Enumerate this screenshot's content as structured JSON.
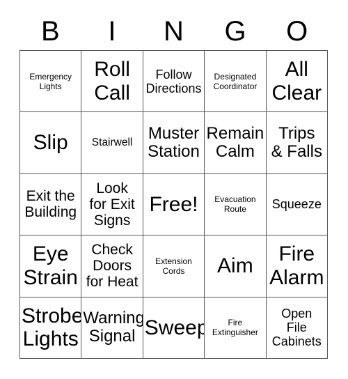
{
  "card": {
    "title": "BINGO",
    "header_letters": [
      "B",
      "I",
      "N",
      "G",
      "O"
    ],
    "rows": 5,
    "columns": 5,
    "border_color": "#555555",
    "text_color": "#000000",
    "background_color": "#ffffff"
  },
  "grid": {
    "cells": [
      {
        "text": "Emergency\nLights",
        "size": "fs-xs",
        "column": "B",
        "row": 1,
        "free": false
      },
      {
        "text": "Roll\nCall",
        "size": "fs-xxl",
        "column": "I",
        "row": 1,
        "free": false
      },
      {
        "text": "Follow\nDirections",
        "size": "fs-md",
        "column": "N",
        "row": 1,
        "free": false
      },
      {
        "text": "Designated\nCoordinator",
        "size": "fs-xs",
        "column": "G",
        "row": 1,
        "free": false
      },
      {
        "text": "All\nClear",
        "size": "fs-xxl",
        "column": "O",
        "row": 1,
        "free": false
      },
      {
        "text": "Slip",
        "size": "fs-xxl",
        "column": "B",
        "row": 2,
        "free": false
      },
      {
        "text": "Stairwell",
        "size": "fs-sm",
        "column": "I",
        "row": 2,
        "free": false
      },
      {
        "text": "Muster\nStation",
        "size": "fs-xl",
        "column": "N",
        "row": 2,
        "free": false
      },
      {
        "text": "Remain\nCalm",
        "size": "fs-xl",
        "column": "G",
        "row": 2,
        "free": false
      },
      {
        "text": "Trips\n& Falls",
        "size": "fs-xl",
        "column": "O",
        "row": 2,
        "free": false
      },
      {
        "text": "Exit the\nBuilding",
        "size": "fs-lg",
        "column": "B",
        "row": 3,
        "free": false
      },
      {
        "text": "Look\nfor Exit\nSigns",
        "size": "fs-lg",
        "column": "I",
        "row": 3,
        "free": false
      },
      {
        "text": "Free!",
        "size": "fs-xxl",
        "column": "N",
        "row": 3,
        "free": true
      },
      {
        "text": "Evacuation\nRoute",
        "size": "fs-xs",
        "column": "G",
        "row": 3,
        "free": false
      },
      {
        "text": "Squeeze",
        "size": "fs-md",
        "column": "O",
        "row": 3,
        "free": false
      },
      {
        "text": "Eye\nStrain",
        "size": "fs-xxl",
        "column": "B",
        "row": 4,
        "free": false
      },
      {
        "text": "Check\nDoors\nfor Heat",
        "size": "fs-lg",
        "column": "I",
        "row": 4,
        "free": false
      },
      {
        "text": "Extension\nCords",
        "size": "fs-xs",
        "column": "N",
        "row": 4,
        "free": false
      },
      {
        "text": "Aim",
        "size": "fs-xxl",
        "column": "G",
        "row": 4,
        "free": false
      },
      {
        "text": "Fire\nAlarm",
        "size": "fs-xxl",
        "column": "O",
        "row": 4,
        "free": false
      },
      {
        "text": "Strobe\nLights",
        "size": "fs-xxl",
        "column": "B",
        "row": 5,
        "free": false
      },
      {
        "text": "Warning\nSignal",
        "size": "fs-xl",
        "column": "I",
        "row": 5,
        "free": false
      },
      {
        "text": "Sweep",
        "size": "fs-xxl",
        "column": "N",
        "row": 5,
        "free": false
      },
      {
        "text": "Fire\nExtinguisher",
        "size": "fs-xs",
        "column": "G",
        "row": 5,
        "free": false
      },
      {
        "text": "Open\nFile\nCabinets",
        "size": "fs-md",
        "column": "O",
        "row": 5,
        "free": false
      }
    ]
  }
}
